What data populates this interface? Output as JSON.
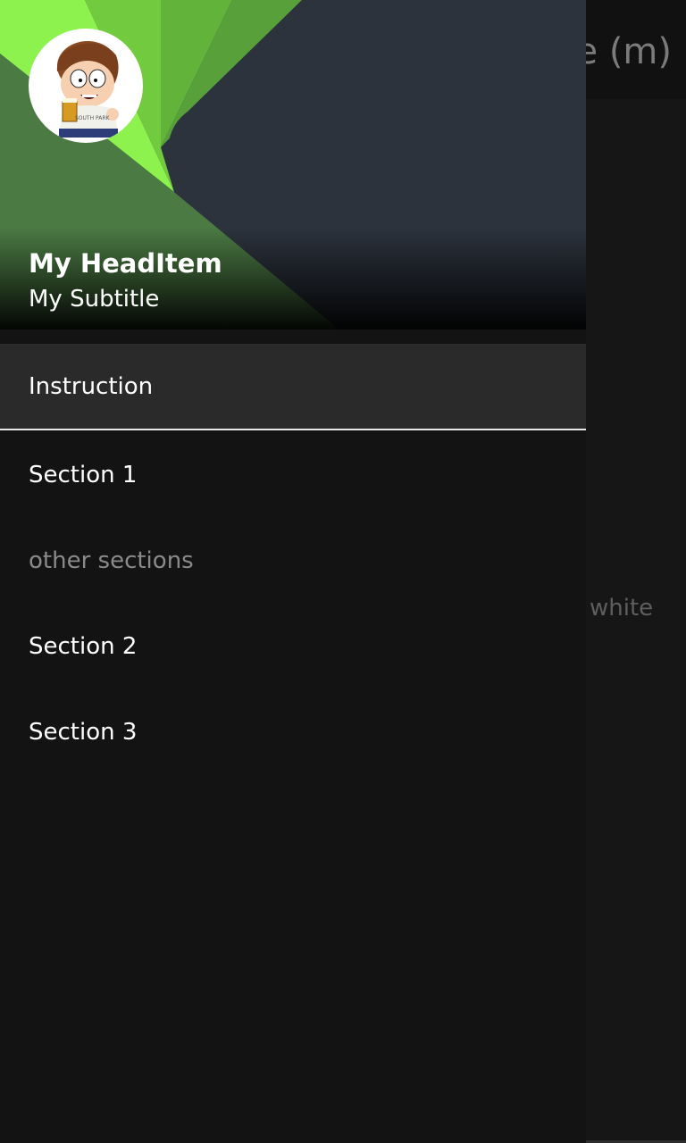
{
  "background": {
    "toolbar_title": "Example (m)",
    "content_label": "white"
  },
  "drawer": {
    "header": {
      "title": "My HeadItem",
      "subtitle": "My Subtitle",
      "avatar_text": "SOUTH PARK"
    },
    "items": [
      {
        "label": "Instruction",
        "selected": true
      },
      {
        "label": "Section 1"
      },
      {
        "label": "other sections",
        "type": "section-header"
      },
      {
        "label": "Section 2"
      },
      {
        "label": "Section 3"
      }
    ]
  },
  "colors": {
    "accent_green": "#8df14e",
    "drawer_bg": "#131313",
    "header_dark": "#2c333d",
    "selected_item_bg": "#2a2a2a"
  }
}
